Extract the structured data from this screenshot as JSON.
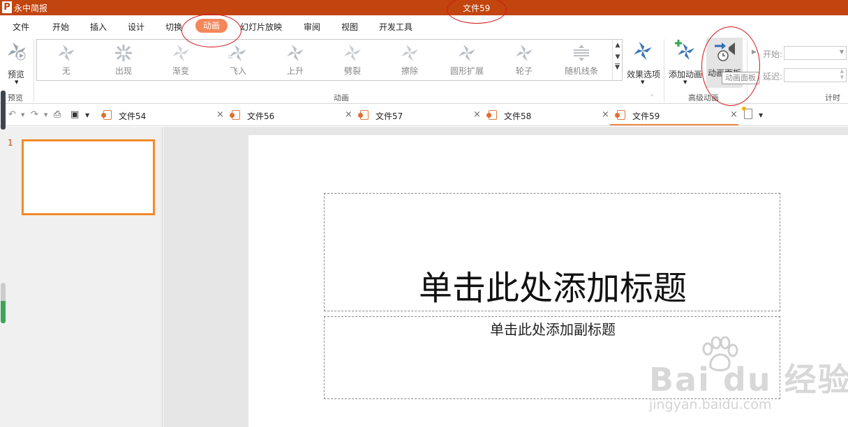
{
  "app": {
    "logo_letter": "P",
    "name": "永中简报",
    "document_title": "文件59",
    "brand_color": "#c2440e",
    "accent_color": "#f3875a"
  },
  "menu": {
    "items": [
      "文件",
      "开始",
      "插入",
      "设计",
      "切换",
      "动画",
      "幻灯片放映",
      "审阅",
      "视图",
      "开发工具"
    ],
    "active": "动画"
  },
  "ribbon": {
    "preview": {
      "label": "预览",
      "group_label": "预览"
    },
    "gallery": {
      "items": [
        "无",
        "出现",
        "渐变",
        "飞入",
        "上升",
        "劈裂",
        "擦除",
        "圆形扩展",
        "轮子",
        "随机线条"
      ],
      "group_label": "动画"
    },
    "effect_options": {
      "label": "效果选项"
    },
    "add_animation": {
      "label": "添加动画"
    },
    "animation_pane": {
      "label": "动画面板",
      "tooltip": "动画面板"
    },
    "advanced_group_label": "高级动画",
    "timing": {
      "start_label": "开始:",
      "delay_label": "延迟:",
      "group_label": "计时",
      "start_value": "",
      "delay_value": ""
    }
  },
  "tabs": {
    "items": [
      "文件54",
      "文件56",
      "文件57",
      "文件58",
      "文件59"
    ],
    "active": "文件59"
  },
  "slides_panel": {
    "slide_number": "1"
  },
  "slide": {
    "title_placeholder": "单击此处添加标题",
    "subtitle_placeholder": "单击此处添加副标题"
  },
  "watermark": {
    "text": "Bai du 经验",
    "url": "jingyan.baidu.com"
  }
}
